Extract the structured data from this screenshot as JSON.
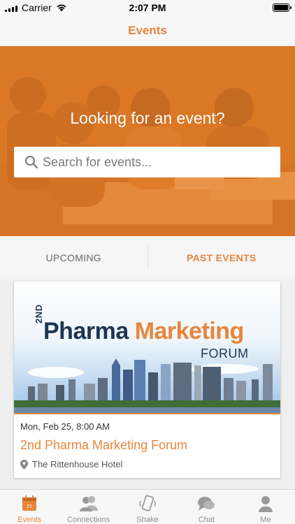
{
  "status_bar": {
    "carrier": "Carrier",
    "time": "2:07 PM"
  },
  "nav": {
    "title": "Events"
  },
  "hero": {
    "title": "Looking for an event?"
  },
  "search": {
    "placeholder": "Search for events..."
  },
  "tabs": {
    "upcoming": "UPCOMING",
    "past": "PAST EVENTS",
    "selected": "past"
  },
  "event": {
    "banner_ordinal": "2ND",
    "banner_word1": "Pharma",
    "banner_word2": "Marketing",
    "banner_sub": "FORUM",
    "date": "Mon, Feb 25, 8:00 AM",
    "title": "2nd Pharma Marketing Forum",
    "location": "The Rittenhouse Hotel"
  },
  "tab_bar": [
    {
      "label": "Events",
      "icon": "calendar-icon",
      "day": "21",
      "active": true
    },
    {
      "label": "Connections",
      "icon": "connections-icon"
    },
    {
      "label": "Shake",
      "icon": "shake-icon"
    },
    {
      "label": "Chat",
      "icon": "chat-icon"
    },
    {
      "label": "Me",
      "icon": "person-icon"
    }
  ],
  "colors": {
    "accent": "#e8853a",
    "navy": "#1e3550"
  }
}
